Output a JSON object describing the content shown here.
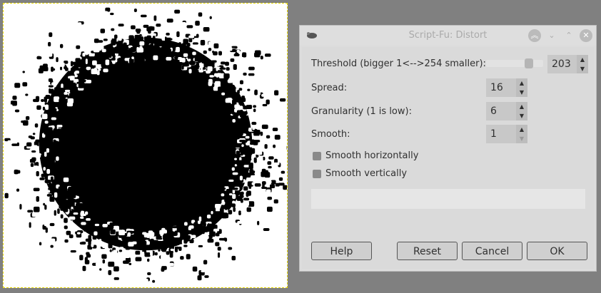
{
  "dialog": {
    "title": "Script-Fu: Distort",
    "threshold": {
      "label": "Threshold (bigger 1<-->254 smaller):",
      "value": "203",
      "slider_fraction": 0.8
    },
    "spread": {
      "label": "Spread:",
      "value": "16"
    },
    "granularity": {
      "label": "Granularity (1 is low):",
      "value": "6"
    },
    "smooth": {
      "label": "Smooth:",
      "value": "1"
    },
    "smooth_h": {
      "label": "Smooth horizontally",
      "checked": false
    },
    "smooth_v": {
      "label": "Smooth vertically",
      "checked": false
    },
    "buttons": {
      "help": "Help",
      "reset": "Reset",
      "cancel": "Cancel",
      "ok": "OK"
    }
  }
}
